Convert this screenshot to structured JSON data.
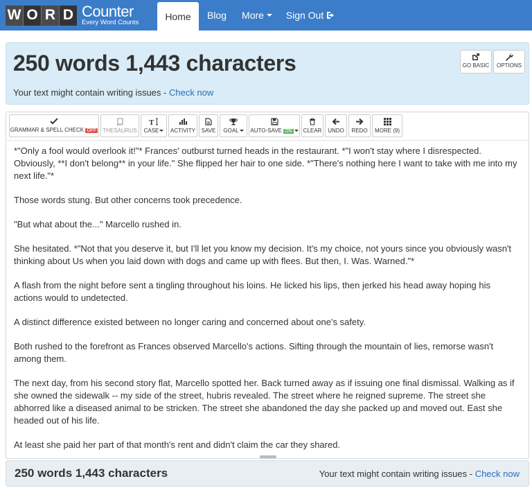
{
  "logo": {
    "letters": [
      "W",
      "O",
      "R",
      "D"
    ],
    "title": "Counter",
    "tagline": "Every Word Counts"
  },
  "nav": {
    "items": [
      {
        "label": "Home",
        "active": true
      },
      {
        "label": "Blog",
        "active": false
      },
      {
        "label": "More",
        "active": false
      },
      {
        "label": "Sign Out",
        "active": false
      }
    ]
  },
  "summary": {
    "title": "250 words 1,443 characters",
    "issue_text": "Your text might contain writing issues -",
    "issue_link": "Check now",
    "buttons": [
      {
        "label": "GO BASIC",
        "icon": "external-link-icon"
      },
      {
        "label": "OPTIONS",
        "icon": "wrench-icon"
      }
    ]
  },
  "toolbar": {
    "grammar": {
      "label": "GRAMMAR & SPELL CHECK",
      "state": "OFF",
      "icon": "check-icon"
    },
    "thesaurus": {
      "label": "THESAURUS",
      "icon": "book-icon"
    },
    "case": {
      "label": "CASE",
      "icon": "text-height-icon"
    },
    "activity": {
      "label": "ACTIVITY",
      "icon": "bar-chart-icon"
    },
    "save": {
      "label": "SAVE",
      "icon": "document-icon"
    },
    "goal": {
      "label": "GOAL",
      "icon": "trophy-icon"
    },
    "autosave": {
      "label": "AUTO-SAVE",
      "state": "ON",
      "icon": "floppy-disk-icon"
    },
    "clear": {
      "label": "CLEAR",
      "icon": "trash-icon"
    },
    "undo": {
      "label": "UNDO",
      "icon": "arrow-left-icon"
    },
    "redo": {
      "label": "REDO",
      "icon": "arrow-right-icon"
    },
    "more": {
      "label": "MORE (9)",
      "icon": "grid-icon"
    }
  },
  "editor": {
    "paragraphs": [
      "*\"Only a fool would overlook it!\"* Frances' outburst turned heads in the restaurant. *\"I won't stay where I disrespected. Obviously, **I don't belong** in your life.\" She flipped her hair to one side. *\"There's nothing here I want to take with me into my next life.\"*",
      "Those words stung. But other concerns took precedence.",
      "\"But what about the...\" Marcello rushed in.",
      "She hesitated. *\"Not that you deserve it, but I'll let you know my decision. It's my choice, not yours since you obviously wasn't thinking about Us when you laid down with dogs and came up with flees. But then, I. Was. Warned.\"*",
      "A flash from the night before sent a tingling throughout his loins. He licked his lips, then jerked his head away hoping his actions would to undetected.",
      "A distinct difference existed between no longer caring and concerned about one's safety.",
      "Both rushed to the forefront as Frances observed Marcello's actions. Sifting through the mountain of lies, remorse wasn't among them.",
      "The next day, from his second story flat, Marcello spotted her. Back turned away as if issuing one final dismissal. Walking as if she owned the sidewalk -- my side of the street, hubris revealed.  The street where he reigned supreme. The street she abhorred like a diseased animal to be stricken. The street she abandoned the day she packed up and moved out. East she headed out of his life.",
      "At least she paid her part of that month's rent and didn't claim the car they shared."
    ]
  },
  "footer": {
    "count": "250 words 1,443 characters",
    "issue_text": "Your text might contain writing issues -",
    "issue_link": "Check now"
  }
}
